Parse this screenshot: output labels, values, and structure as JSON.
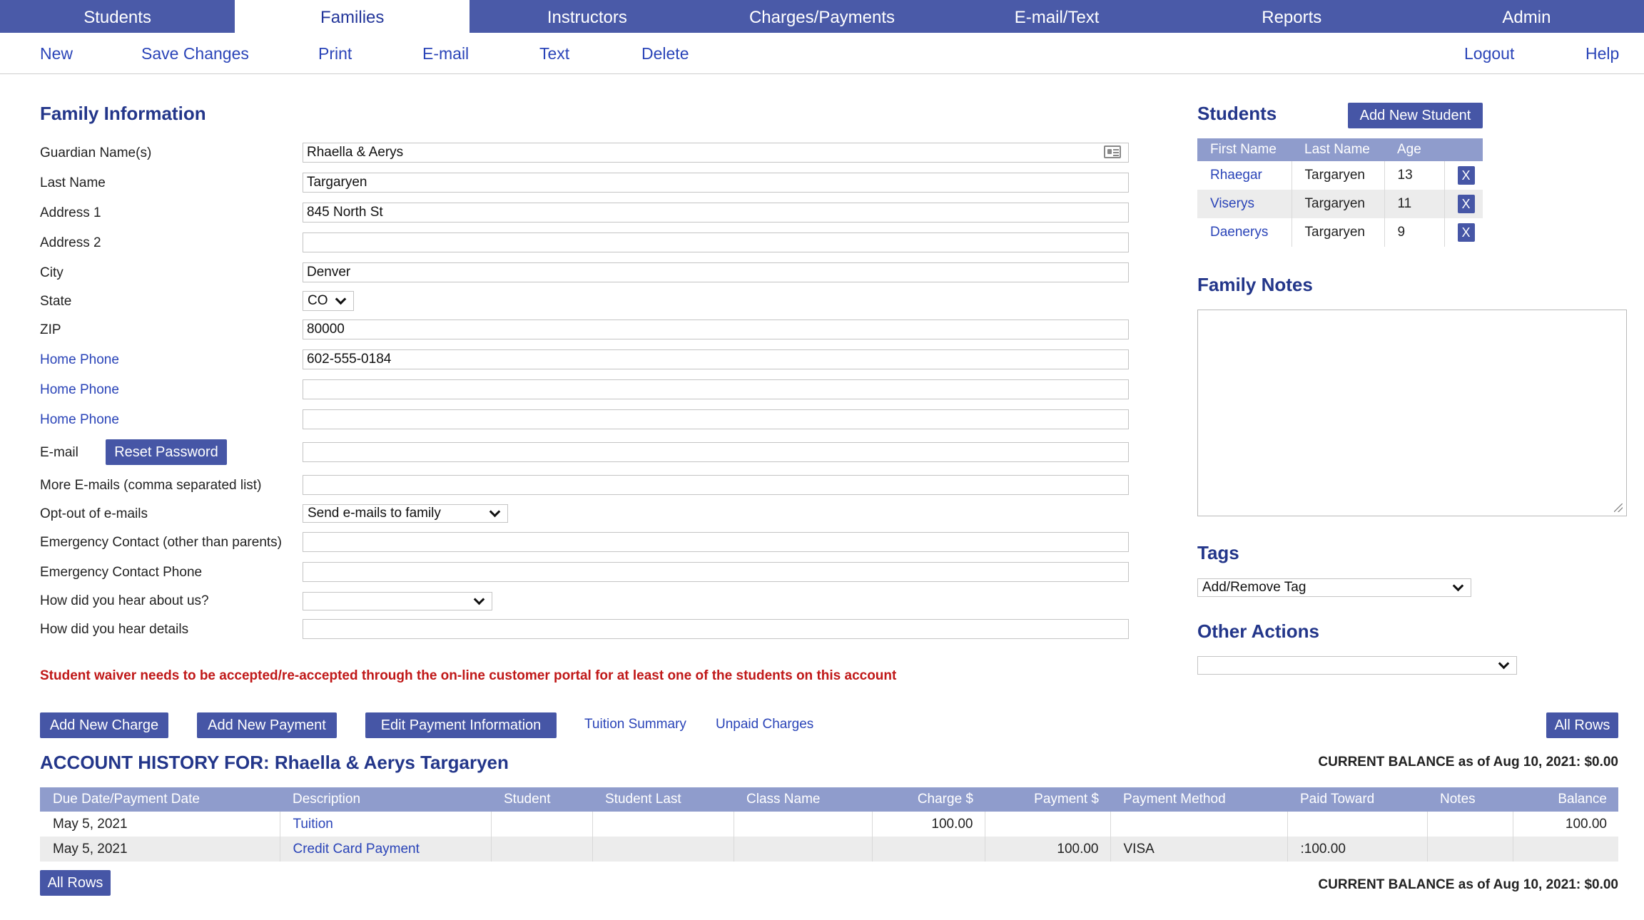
{
  "nav": {
    "tabs": [
      "Students",
      "Families",
      "Instructors",
      "Charges/Payments",
      "E-mail/Text",
      "Reports",
      "Admin"
    ],
    "active": "Families"
  },
  "actions": {
    "new": "New",
    "save": "Save Changes",
    "print": "Print",
    "email": "E-mail",
    "text": "Text",
    "delete": "Delete",
    "logout": "Logout",
    "help": "Help"
  },
  "family": {
    "heading": "Family Information",
    "labels": {
      "guardian": "Guardian Name(s)",
      "last_name": "Last Name",
      "address1": "Address 1",
      "address2": "Address 2",
      "city": "City",
      "state": "State",
      "zip": "ZIP",
      "phone1": "Home Phone",
      "phone2": "Home Phone",
      "phone3": "Home Phone",
      "email": "E-mail",
      "more_emails": "More E-mails (comma separated list)",
      "optout": "Opt-out of e-mails",
      "emergency": "Emergency Contact (other than parents)",
      "emergency_phone": "Emergency Contact Phone",
      "hear": "How did you hear about us?",
      "hear_details": "How did you hear details"
    },
    "values": {
      "guardian": "Rhaella & Aerys",
      "last_name": "Targaryen",
      "address1": "845 North St",
      "address2": "",
      "city": "Denver",
      "state": "CO",
      "zip": "80000",
      "phone1": "602-555-0184",
      "phone2": "",
      "phone3": "",
      "email": "",
      "more_emails": "",
      "optout": "Send e-mails to family",
      "emergency": "",
      "emergency_phone": "",
      "hear": "",
      "hear_details": ""
    },
    "reset_password": "Reset Password",
    "warning": "Student waiver needs to be accepted/re-accepted through the on-line customer portal for at least one of the students on this account"
  },
  "students": {
    "heading": "Students",
    "add_button": "Add New Student",
    "columns": [
      "First Name",
      "Last Name",
      "Age"
    ],
    "rows": [
      {
        "first": "Rhaegar",
        "last": "Targaryen",
        "age": "13"
      },
      {
        "first": "Viserys",
        "last": "Targaryen",
        "age": "11"
      },
      {
        "first": "Daenerys",
        "last": "Targaryen",
        "age": "9"
      }
    ],
    "remove_label": "X"
  },
  "notes": {
    "heading": "Family Notes",
    "value": ""
  },
  "tags": {
    "heading": "Tags",
    "select": "Add/Remove Tag"
  },
  "other": {
    "heading": "Other Actions",
    "select": ""
  },
  "history": {
    "buttons": {
      "add_charge": "Add New Charge",
      "add_payment": "Add New Payment",
      "edit_payment": "Edit Payment Information"
    },
    "links": {
      "tuition": "Tuition Summary",
      "unpaid": "Unpaid Charges"
    },
    "all_rows": "All Rows",
    "title": "ACCOUNT HISTORY FOR: Rhaella & Aerys Targaryen",
    "balance": "CURRENT BALANCE as of Aug 10, 2021: $0.00",
    "columns": [
      "Due Date/Payment Date",
      "Description",
      "Student",
      "Student Last",
      "Class Name",
      "Charge $",
      "Payment $",
      "Payment Method",
      "Paid Toward",
      "Notes",
      "Balance"
    ],
    "rows": [
      {
        "date": "May 5, 2021",
        "desc": "Tuition",
        "student": "",
        "student_last": "",
        "class": "",
        "charge": "100.00",
        "payment": "",
        "method": "",
        "toward": "",
        "notes": "",
        "balance": "100.00"
      },
      {
        "date": "May 5, 2021",
        "desc": "Credit Card Payment",
        "student": "",
        "student_last": "",
        "class": "",
        "charge": "",
        "payment": "100.00",
        "method": "VISA",
        "toward": ":100.00",
        "notes": "",
        "balance": ""
      }
    ]
  }
}
